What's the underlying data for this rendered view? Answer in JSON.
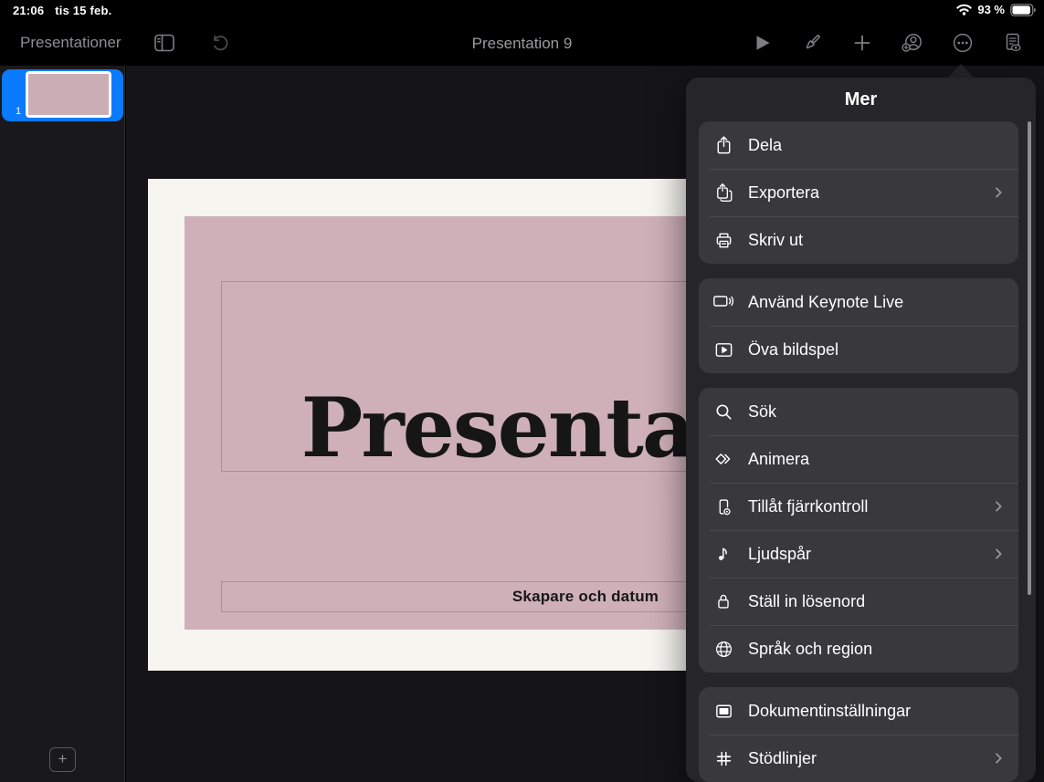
{
  "status_bar": {
    "time": "21:06",
    "date": "tis 15 feb.",
    "battery_percent": "93 %"
  },
  "toolbar": {
    "back_label": "Presentationer",
    "title": "Presentation 9"
  },
  "sidebar": {
    "slide_number": "1",
    "add_slide_label": "+"
  },
  "slide": {
    "title": "Presentation",
    "subtitle": "Skapare och datum"
  },
  "popover": {
    "title": "Mer",
    "groups": [
      {
        "items": [
          {
            "label": "Dela",
            "icon": "share-icon",
            "chevron": false
          },
          {
            "label": "Exportera",
            "icon": "export-icon",
            "chevron": true
          },
          {
            "label": "Skriv ut",
            "icon": "printer-icon",
            "chevron": false
          }
        ]
      },
      {
        "items": [
          {
            "label": "Använd Keynote Live",
            "icon": "keynote-live-icon",
            "chevron": false
          },
          {
            "label": "Öva bildspel",
            "icon": "rehearse-slideshow-icon",
            "chevron": false
          }
        ]
      },
      {
        "items": [
          {
            "label": "Sök",
            "icon": "search-icon",
            "chevron": false
          },
          {
            "label": "Animera",
            "icon": "animate-icon",
            "chevron": false
          },
          {
            "label": "Tillåt fjärrkontroll",
            "icon": "remote-control-icon",
            "chevron": true
          },
          {
            "label": "Ljudspår",
            "icon": "soundtrack-icon",
            "chevron": true
          },
          {
            "label": "Ställ in lösenord",
            "icon": "password-lock-icon",
            "chevron": false
          },
          {
            "label": "Språk och region",
            "icon": "language-region-icon",
            "chevron": false
          }
        ]
      },
      {
        "items": [
          {
            "label": "Dokumentinställningar",
            "icon": "document-settings-icon",
            "chevron": false
          },
          {
            "label": "Stödlinjer",
            "icon": "guides-icon",
            "chevron": true
          }
        ]
      }
    ]
  },
  "colors": {
    "accent_blue": "#0a7aff",
    "slide_pink": "#cfb0b8",
    "slide_cream": "#f6f5ef",
    "popover_bg": "#262628",
    "card_bg": "#39393c"
  }
}
